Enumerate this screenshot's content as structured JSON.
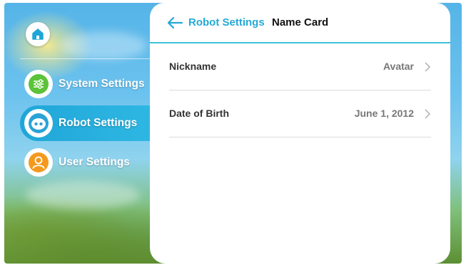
{
  "sidebar": {
    "home": {
      "icon": "home-icon"
    },
    "items": [
      {
        "label": "System Settings",
        "icon": "sliders-icon",
        "icon_color": "#5cc23a",
        "active": false
      },
      {
        "label": "Robot Settings",
        "icon": "robot-icon",
        "icon_color": "#ffffff",
        "active": true
      },
      {
        "label": "User Settings",
        "icon": "user-icon",
        "icon_color": "#f39a1e",
        "active": false
      }
    ]
  },
  "panel": {
    "back_label": "Robot Settings",
    "title": "Name Card",
    "rows": [
      {
        "label": "Nickname",
        "value": "Avatar"
      },
      {
        "label": "Date of Birth",
        "value": "June 1, 2012"
      }
    ]
  },
  "colors": {
    "accent": "#25a9d6",
    "active_nav": "#1fa6d8",
    "header_underline": "#3ec3db"
  }
}
